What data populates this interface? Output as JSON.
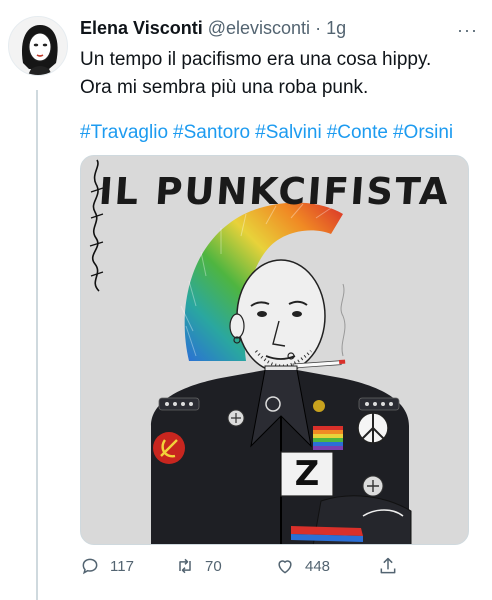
{
  "tweet": {
    "author_name": "Elena Visconti",
    "handle": "@elevisconti",
    "separator": "·",
    "time": "1g",
    "more": "···",
    "text_line1": "Un tempo il pacifismo era una cosa hippy.",
    "text_line2": "Ora mi sembra più una roba punk.",
    "hashtags": [
      "#Travaglio",
      "#Santoro",
      "#Salvini",
      "#Conte",
      "#Orsini"
    ]
  },
  "media": {
    "title": "IL PUNKCIFISTA",
    "badge_letter": "Z"
  },
  "actions": {
    "replies": "117",
    "retweets": "70",
    "likes": "448"
  },
  "colors": {
    "accent": "#1d9bf0",
    "muted": "#536471",
    "jacket": "#1e1f24"
  },
  "icons": [
    "reply-icon",
    "retweet-icon",
    "like-icon",
    "share-icon",
    "more-icon"
  ]
}
